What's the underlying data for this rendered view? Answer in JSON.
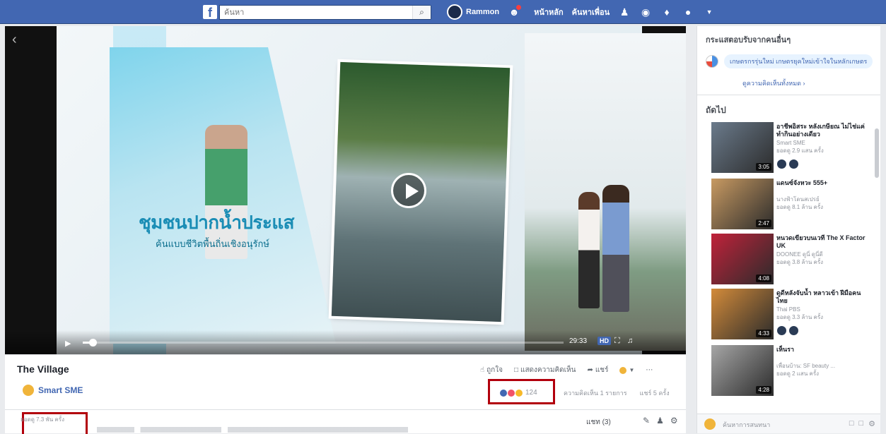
{
  "topbar": {
    "logo": "f",
    "search_placeholder": "ค้นหา",
    "search_icon": "magnifier-icon",
    "username": "Rammon",
    "home": "หน้าหลัก",
    "find_friends": "ค้นหาเพื่อน",
    "icons": [
      "friends-icon",
      "messenger-icon",
      "notifications-icon",
      "help-icon",
      "dropdown-icon"
    ]
  },
  "video": {
    "overlay_title": "ชุมชนปากน้ำประแส",
    "overlay_subtitle": "ค้นแบบชีวิตพื้นถิ่นเชิงอนุรักษ์",
    "time": "29:33",
    "hd": "HD",
    "progress": 0.02
  },
  "info": {
    "title": "The Village",
    "page_name": "Smart SME",
    "actions": [
      "ถูกใจ",
      "แสดงความคิดเห็น",
      "แชร์"
    ],
    "reaction_count": "124",
    "comments": "ความคิดเห็น 1 รายการ",
    "shares": "แชร์ 5 ครั้ง"
  },
  "bottom": {
    "views_meta": "ยอดดู 7.3 พัน ครั้ง",
    "comment_tab": "แชท (3)"
  },
  "right": {
    "header": "กระแสตอบรับจากคนอื่นๆ",
    "shared_pill": "เกษตรกรรุ่นใหม่ เกษตรยุคใหม่เข้าใจในหลักเกษตร",
    "see_all": "ดูความคิดเห็นทั้งหมด",
    "up_next": "ถัดไป",
    "videos": [
      {
        "title": "อาชีพอิสระ หลังเกษียณ ไม่ไช่แค่ทำกินอย่างเดียว",
        "source": "Smart SME",
        "views": "ยอดดู 2.9 แสน ครั้ง",
        "duration": "3:05",
        "color": "#6b7b8c"
      },
      {
        "title": "แดนซ์จังหวะ 555+",
        "source": "นางฟ้าโดนสเปรย์",
        "views": "ยอดดู 8.1 ล้าน ครั้ง",
        "duration": "2:47",
        "color": "#c89a62"
      },
      {
        "title": "หนวดเขียวบนเวที The X Factor UK",
        "source": "DOONEE ดูนี่ ดูนี่ดี",
        "views": "ยอดดู 3.8 ล้าน ครั้ง",
        "duration": "4:08",
        "color": "#c0223a"
      },
      {
        "title": "ดูดีหลังจับน้ำ หลาวเข้า ฝีมือคนไทย",
        "source": "Thai PBS",
        "views": "ยอดดู 3.3 ล้าน ครั้ง",
        "duration": "4:33",
        "color": "#d38b3a"
      },
      {
        "title": "เห็นรา",
        "source": "เพื่อนบ้าน: SF beauty ...",
        "views": "ยอดดู 2 แสน ครั้ง",
        "duration": "4:28",
        "color": "#a6a6a6"
      }
    ],
    "chat_placeholder": "ค้นหาการสนทนา"
  }
}
